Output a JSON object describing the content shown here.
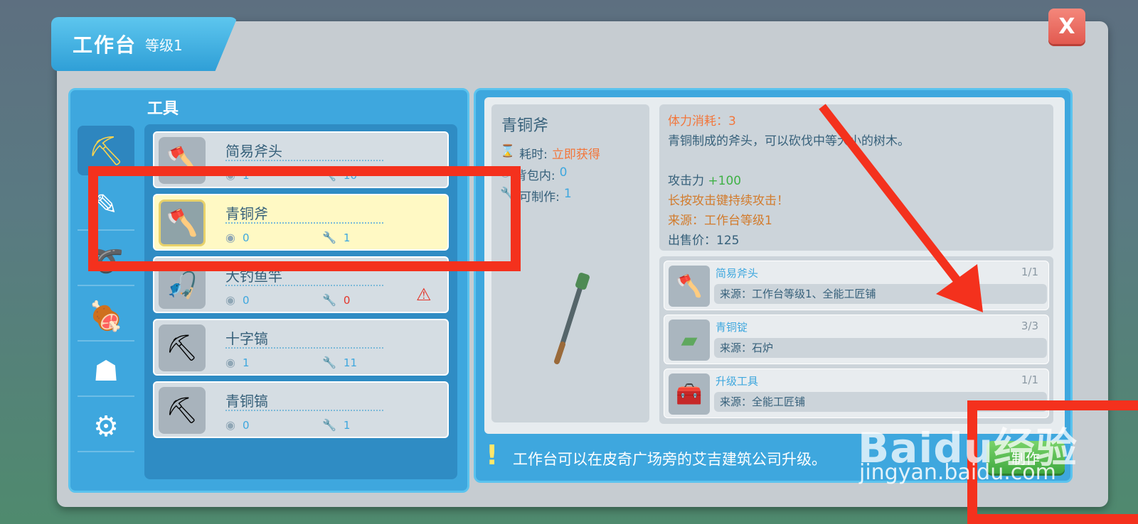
{
  "window": {
    "title": "工作台",
    "level": "等级1",
    "close_label": "X"
  },
  "category": {
    "label": "工具"
  },
  "sidebar": {
    "items": [
      {
        "icon": "pickaxe-icon",
        "glyph": "⛏",
        "active": true
      },
      {
        "icon": "carrot-icon",
        "glyph": "✎",
        "active": false
      },
      {
        "icon": "rope-icon",
        "glyph": "➰",
        "active": false
      },
      {
        "icon": "meat-icon",
        "glyph": "🍖",
        "active": false
      },
      {
        "icon": "stool-icon",
        "glyph": "☗",
        "active": false
      },
      {
        "icon": "gear-icon",
        "glyph": "⚙",
        "active": false
      }
    ]
  },
  "list": {
    "items": [
      {
        "name": "简易斧头",
        "bag": "1",
        "craftable": "10",
        "thumb": "🪓",
        "selected": false
      },
      {
        "name": "青铜斧",
        "bag": "0",
        "craftable": "1",
        "thumb": "🪓",
        "selected": true
      },
      {
        "name": "大钓鱼竿",
        "bag": "0",
        "craftable": "0",
        "thumb": "🎣",
        "selected": false
      },
      {
        "name": "十字镐",
        "bag": "1",
        "craftable": "11",
        "thumb": "⛏",
        "selected": false
      },
      {
        "name": "青铜镐",
        "bag": "0",
        "craftable": "1",
        "thumb": "⛏",
        "selected": false
      }
    ]
  },
  "detail": {
    "name": "青铜斧",
    "time_label": "耗时:",
    "time_value": "立即获得",
    "bag_label": "背包内:",
    "bag_value": "0",
    "craft_label": "可制作:",
    "craft_value": "1",
    "stamina": "体力消耗：3",
    "description": "青铜制成的斧头，可以砍伐中等大小的树木。",
    "attack_label": "攻击力",
    "attack_value": "+100",
    "hold_tip": "长按攻击键持续攻击！",
    "source": "来源：工作台等级1",
    "price": "出售价：125"
  },
  "materials": [
    {
      "name": "简易斧头",
      "count": "1/1",
      "source": "来源：工作台等级1、全能工匠铺",
      "thumb": "🪓"
    },
    {
      "name": "青铜锭",
      "count": "3/3",
      "source": "来源：石炉",
      "thumb": "▰"
    },
    {
      "name": "升级工具",
      "count": "1/1",
      "source": "来源：全能工匠铺",
      "thumb": "🧰"
    }
  ],
  "footer": {
    "tip": "工作台可以在皮奇广场旁的艾吉建筑公司升级。",
    "make_label": "制作"
  },
  "watermark": {
    "main": "Baidu经验",
    "sub": "jingyan.baidu.com"
  },
  "colors": {
    "panel_blue": "#3ea7de",
    "highlight_red": "#f4311d",
    "selected_yellow": "#fff9c4",
    "make_green": "#3fa940"
  }
}
